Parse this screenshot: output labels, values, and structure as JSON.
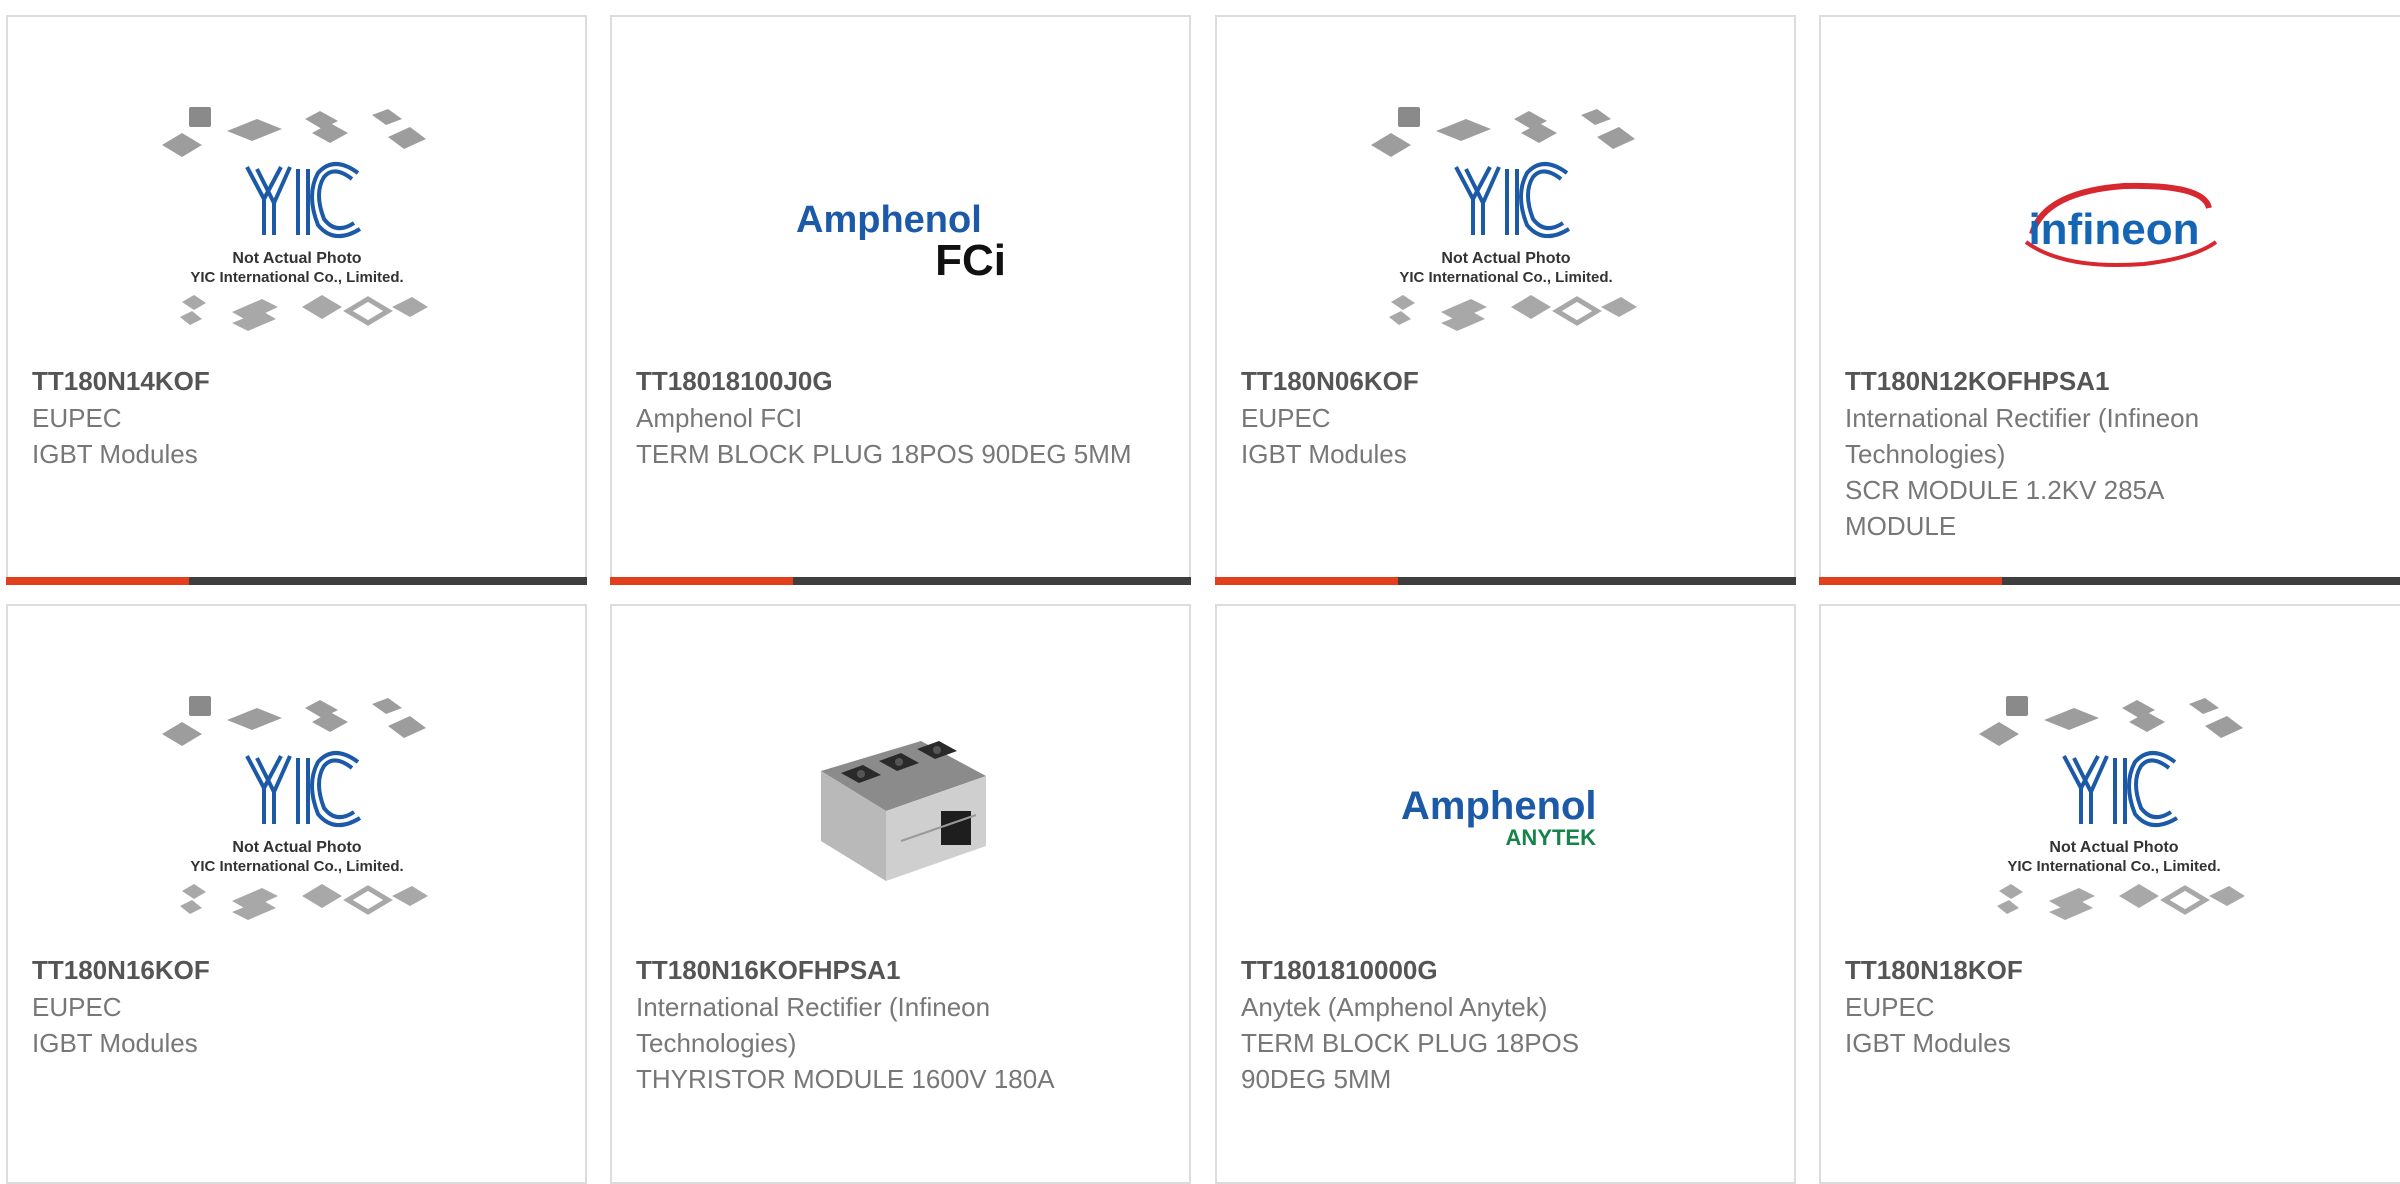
{
  "cards": [
    {
      "part": "TT180N14KOF",
      "maker": "EUPEC",
      "desc": "IGBT Modules",
      "image": "yic-placeholder"
    },
    {
      "part": "TT18018100J0G",
      "maker": "Amphenol FCI",
      "desc": "TERM BLOCK PLUG 18POS 90DEG 5MM",
      "image": "amphenol-fci-logo"
    },
    {
      "part": "TT180N06KOF",
      "maker": "EUPEC",
      "desc": "IGBT Modules",
      "image": "yic-placeholder"
    },
    {
      "part": "TT180N12KOFHPSA1",
      "maker": "International Rectifier (Infineon Technologies)",
      "desc": "SCR MODULE 1.2KV 285A MODULE",
      "image": "infineon-logo"
    },
    {
      "part": "TT180N16KOF",
      "maker": "EUPEC",
      "desc": "IGBT Modules",
      "image": "yic-placeholder"
    },
    {
      "part": "TT180N16KOFHPSA1",
      "maker": "International Rectifier (Infineon Technologies)",
      "desc": "THYRISTOR MODULE 1600V 180A",
      "image": "thyristor-module-photo"
    },
    {
      "part": "TT1801810000G",
      "maker": "Anytek (Amphenol Anytek)",
      "desc": "TERM BLOCK PLUG 18POS 90DEG 5MM",
      "image": "amphenol-anytek-logo"
    },
    {
      "part": "TT180N18KOF",
      "maker": "EUPEC",
      "desc": "IGBT Modules",
      "image": "yic-placeholder"
    }
  ],
  "placeholder": {
    "line1": "Not Actual Photo",
    "line2": "YIC International Co., Limited.",
    "mark": "YIC"
  },
  "logos": {
    "amphenol": "Amphenol",
    "fci": "FCi",
    "anytek": "ANYTEK",
    "infineon": "infineon"
  },
  "colors": {
    "accent": "#e2401d",
    "bar": "#3e3e3e",
    "amphenol_blue": "#1c5aa8",
    "anytek_green": "#15834a",
    "infineon_blue": "#1466b4",
    "infineon_red": "#d7282f"
  }
}
